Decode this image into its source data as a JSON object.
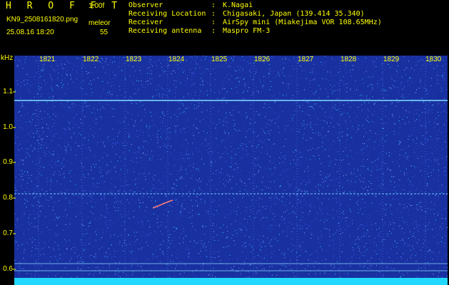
{
  "header": {
    "brand": "H R O F F T",
    "version": "1.00f",
    "filename": "KN9_2508161820.png",
    "datetime": "25.08.16 18:20",
    "mode_label": "meleor",
    "count": "55",
    "observer_label": "Observer",
    "observer_value": "K.Nagai",
    "location_label": "Receiving Location",
    "location_value": "Chigasaki, Japan (139.414 35.340)",
    "receiver_label": "Receiver",
    "receiver_value": "AirSpy mini (Miakejima VOR 108.65MHz)",
    "antenna_label": "Receiving antenna",
    "antenna_value": "Maspro FM-3",
    "colon": ":"
  },
  "axes": {
    "y_unit": "kHz",
    "y_ticks": [
      "1.1",
      "1.0",
      "0.9",
      "0.8",
      "0.7",
      "0.6"
    ],
    "time_ticks": [
      "1821",
      "1822",
      "1823",
      "1824",
      "1825",
      "1826",
      "1827",
      "1828",
      "1829",
      "1830"
    ]
  },
  "colors": {
    "label": "#ffff00",
    "background_noise": "#1a2fa8",
    "signal": "#7fd6ff",
    "bottom_band": "#22d8ff",
    "meteor": "#ff7070"
  }
}
